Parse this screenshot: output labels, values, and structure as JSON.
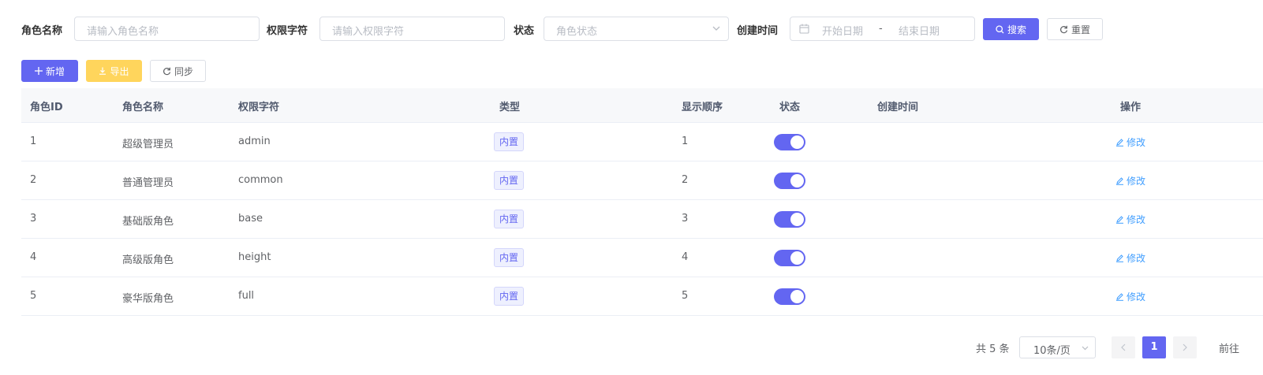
{
  "search": {
    "role_name_label": "角色名称",
    "role_name_placeholder": "请输入角色名称",
    "perm_label": "权限字符",
    "perm_placeholder": "请输入权限字符",
    "status_label": "状态",
    "status_placeholder": "角色状态",
    "created_label": "创建时间",
    "start_placeholder": "开始日期",
    "date_separator": "-",
    "end_placeholder": "结束日期",
    "search_button": "搜索",
    "reset_button": "重置"
  },
  "toolbar": {
    "add_button": "新增",
    "export_button": "导出",
    "sync_button": "同步"
  },
  "table": {
    "headers": {
      "id": "角色ID",
      "name": "角色名称",
      "key": "权限字符",
      "type": "类型",
      "sort": "显示顺序",
      "status": "状态",
      "created": "创建时间",
      "actions": "操作"
    },
    "rows": [
      {
        "id": "1",
        "name": "超级管理员",
        "key": "admin",
        "type": "内置",
        "sort": "1",
        "status_on": true,
        "created": "",
        "edit": "修改"
      },
      {
        "id": "2",
        "name": "普通管理员",
        "key": "common",
        "type": "内置",
        "sort": "2",
        "status_on": true,
        "created": "",
        "edit": "修改"
      },
      {
        "id": "3",
        "name": "基础版角色",
        "key": "base",
        "type": "内置",
        "sort": "3",
        "status_on": true,
        "created": "",
        "edit": "修改"
      },
      {
        "id": "4",
        "name": "高级版角色",
        "key": "height",
        "type": "内置",
        "sort": "4",
        "status_on": true,
        "created": "",
        "edit": "修改"
      },
      {
        "id": "5",
        "name": "豪华版角色",
        "key": "full",
        "type": "内置",
        "sort": "5",
        "status_on": true,
        "created": "",
        "edit": "修改"
      }
    ]
  },
  "pagination": {
    "total_text": "共 5 条",
    "page_size": "10条/页",
    "current_page": "1",
    "goto_label": "前往"
  },
  "colors": {
    "primary": "#6366f1",
    "warning": "#ffd55c",
    "link": "#409eff"
  }
}
